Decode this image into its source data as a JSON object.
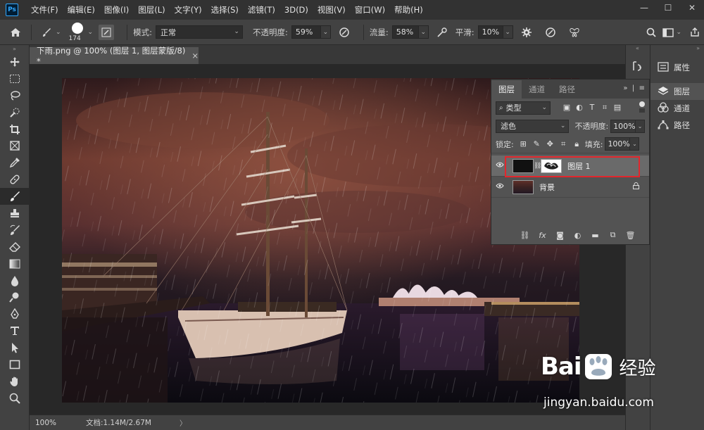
{
  "app": {
    "logo": "Ps"
  },
  "menu": [
    "文件(F)",
    "编辑(E)",
    "图像(I)",
    "图层(L)",
    "文字(Y)",
    "选择(S)",
    "滤镜(T)",
    "3D(D)",
    "视图(V)",
    "窗口(W)",
    "帮助(H)"
  ],
  "window_controls": {
    "minimize": "—",
    "maximize": "☐",
    "close": "✕"
  },
  "options": {
    "brush_size": "174",
    "mode_label": "模式:",
    "mode_value": "正常",
    "opacity_label": "不透明度:",
    "opacity_value": "59%",
    "flow_label": "流量:",
    "flow_value": "58%",
    "smooth_label": "平滑:",
    "smooth_value": "10%"
  },
  "document": {
    "tab_title": "下雨.png @ 100% (图层 1, 图层蒙版/8) *",
    "close": "×"
  },
  "status": {
    "zoom": "100%",
    "doc_info": "文档:1.14M/2.67M",
    "arrow": "〉"
  },
  "right_panels": {
    "items": [
      {
        "label": "属性",
        "icon": "properties-icon"
      },
      {
        "label": "图层",
        "icon": "layers-icon"
      },
      {
        "label": "通道",
        "icon": "channels-icon"
      },
      {
        "label": "路径",
        "icon": "paths-icon"
      }
    ]
  },
  "layers_panel": {
    "tabs": [
      "图层",
      "通道",
      "路径"
    ],
    "active_tab": "图层",
    "kind_filter": "类型",
    "blend_mode": "滤色",
    "opacity_label": "不透明度:",
    "opacity_value": "100%",
    "lock_label": "锁定:",
    "fill_label": "填充:",
    "fill_value": "100%",
    "layers": [
      {
        "name": "图层 1",
        "selected": true,
        "has_mask": true
      },
      {
        "name": "背景",
        "selected": false,
        "locked": true
      }
    ],
    "highlight_color": "#e2262c"
  },
  "watermark": {
    "logo_left": "Bai",
    "logo_right": "经验",
    "url": "jingyan.baidu.com"
  },
  "colors": {
    "menubar": "#323232",
    "panel": "#424242",
    "workspace": "#535353",
    "accent": "#31a8ff"
  }
}
